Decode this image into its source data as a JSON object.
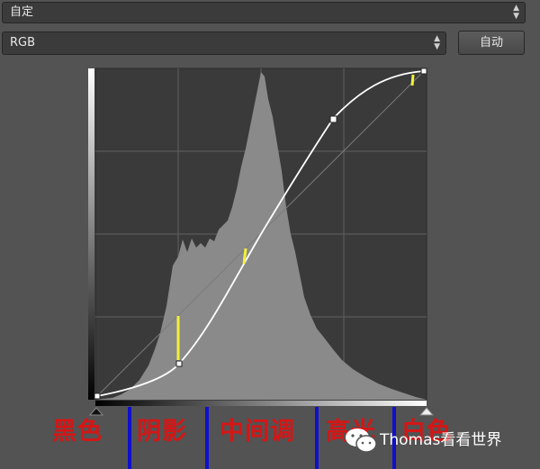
{
  "preset": {
    "value": "自定",
    "icon": "updown-arrows-icon"
  },
  "channel": {
    "value": "RGB",
    "icon": "updown-arrows-icon"
  },
  "auto_button": {
    "label": "自动"
  },
  "zones": [
    {
      "label": "黑色"
    },
    {
      "label": "阴影"
    },
    {
      "label": "中间调"
    },
    {
      "label": "高光"
    },
    {
      "label": "白色"
    }
  ],
  "watermark": {
    "text": "Thomas看看世界",
    "icon": "wechat-icon"
  },
  "colors": {
    "background": "#535353",
    "graph_bg": "#3a3a3a",
    "histogram": "#8a8a8a",
    "curve": "#ffffff",
    "marker": "#f3f03a",
    "zone_text": "#d41616",
    "zone_divider": "#1010cc"
  }
}
